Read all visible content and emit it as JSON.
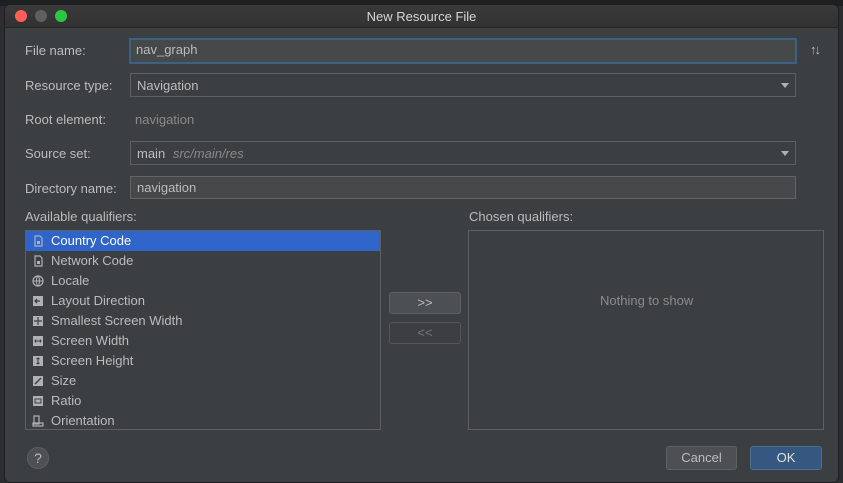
{
  "window": {
    "title": "New Resource File"
  },
  "form": {
    "file_name_label": "File name:",
    "file_name_value": "nav_graph",
    "resource_type_label": "Resource type:",
    "resource_type_value": "Navigation",
    "root_element_label": "Root element:",
    "root_element_value": "navigation",
    "source_set_label": "Source set:",
    "source_set_value": "main",
    "source_set_path": "src/main/res",
    "directory_name_label": "Directory name:",
    "directory_name_value": "navigation"
  },
  "qualifiers": {
    "available_label": "Available qualifiers:",
    "chosen_label": "Chosen qualifiers:",
    "empty_text": "Nothing to show",
    "add_label": ">>",
    "remove_label": "<<",
    "items": [
      {
        "label": "Country Code",
        "icon": "sim-card-icon",
        "selected": true
      },
      {
        "label": "Network Code",
        "icon": "sim-card-icon",
        "selected": false
      },
      {
        "label": "Locale",
        "icon": "globe-icon",
        "selected": false
      },
      {
        "label": "Layout Direction",
        "icon": "layout-direction-icon",
        "selected": false
      },
      {
        "label": "Smallest Screen Width",
        "icon": "smallest-width-icon",
        "selected": false
      },
      {
        "label": "Screen Width",
        "icon": "screen-width-icon",
        "selected": false
      },
      {
        "label": "Screen Height",
        "icon": "screen-height-icon",
        "selected": false
      },
      {
        "label": "Size",
        "icon": "size-icon",
        "selected": false
      },
      {
        "label": "Ratio",
        "icon": "ratio-icon",
        "selected": false
      },
      {
        "label": "Orientation",
        "icon": "orientation-icon",
        "selected": false
      }
    ]
  },
  "footer": {
    "help_label": "?",
    "cancel_label": "Cancel",
    "ok_label": "OK"
  },
  "colors": {
    "dialog_bg": "#3c3f41",
    "selection": "#2f65ca",
    "primary_button": "#365880",
    "focus_border": "#3d6185"
  }
}
